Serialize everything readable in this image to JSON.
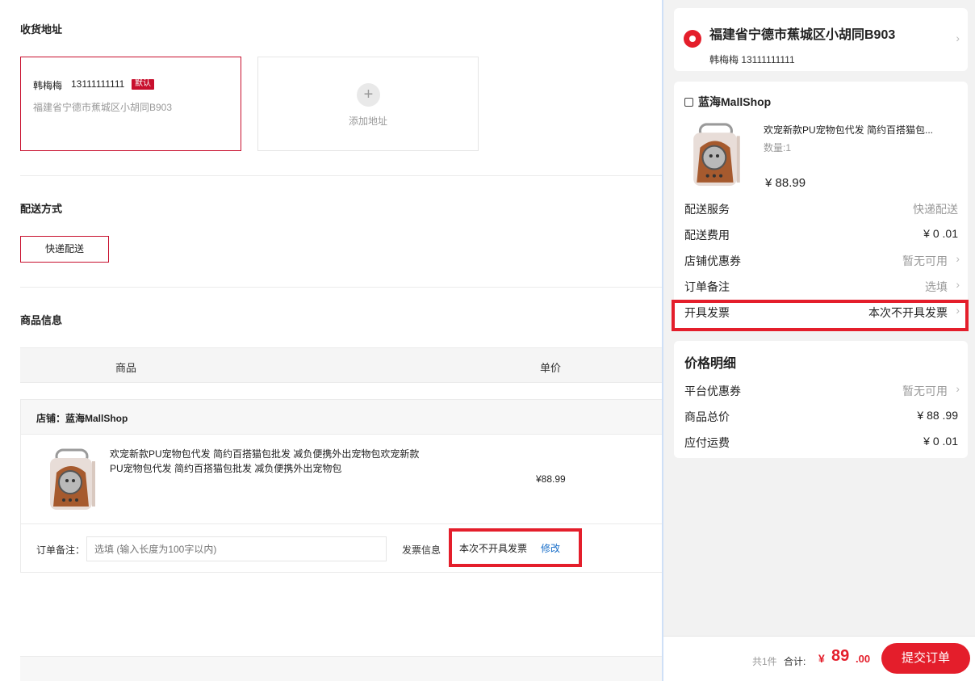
{
  "left": {
    "address_section_title": "收货地址",
    "address_card": {
      "name": "韩梅梅",
      "phone": "13111111111",
      "badge": "默认",
      "detail": "福建省宁德市蕉城区小胡同B903"
    },
    "add_address_label": "添加地址",
    "shipping_section_title": "配送方式",
    "shipping_option": "快递配送",
    "goods_section_title": "商品信息",
    "table_headers": {
      "product": "商品",
      "unit_price": "单价"
    },
    "shop_label": "店铺：蓝海MallShop",
    "product": {
      "title": "欢宠新款PU宠物包代发 简约百搭猫包批发 减负便携外出宠物包欢宠新款PU宠物包代发 简约百搭猫包批发 减负便携外出宠物包",
      "price": "¥88.99"
    },
    "note_label": "订单备注：",
    "note_placeholder": "选填 (输入长度为100字以内)",
    "invoice_label": "发票信息",
    "invoice_value": "本次不开具发票",
    "invoice_edit": "修改"
  },
  "right": {
    "address": {
      "title": "福建省宁德市蕉城区小胡同B903",
      "contact": "韩梅梅 13111111111"
    },
    "shop": {
      "name": "蓝海MallShop",
      "product_title": "欢宠新款PU宠物包代发 简约百搭猫包...",
      "quantity": "数量:1",
      "price": "¥ 88.99"
    },
    "rows": {
      "delivery_service": {
        "label": "配送服务",
        "value": "快递配送"
      },
      "delivery_fee": {
        "label": "配送费用",
        "value": "¥ 0 .01"
      },
      "shop_coupon": {
        "label": "店铺优惠券",
        "value": "暂无可用"
      },
      "order_note": {
        "label": "订单备注",
        "value": "选填"
      },
      "invoice": {
        "label": "开具发票",
        "value": "本次不开具发票"
      }
    },
    "price_detail": {
      "title": "价格明细",
      "platform_coupon": {
        "label": "平台优惠券",
        "value": "暂无可用"
      },
      "goods_total": {
        "label": "商品总价",
        "value": "¥ 88 .99"
      },
      "shipping_payable": {
        "label": "应付运费",
        "value": "¥ 0 .01"
      }
    },
    "footer": {
      "count": "共1件",
      "total_label": "合计:",
      "currency": "¥",
      "total_int": "89",
      "total_dec": ".00",
      "submit": "提交订单"
    }
  },
  "colors": {
    "accent": "#e41e2b",
    "border_selected": "#c8102e",
    "link": "#1a6fc9"
  },
  "icons": [
    "plus-icon",
    "location-pin-icon",
    "shop-icon",
    "chevron-right-icon"
  ]
}
